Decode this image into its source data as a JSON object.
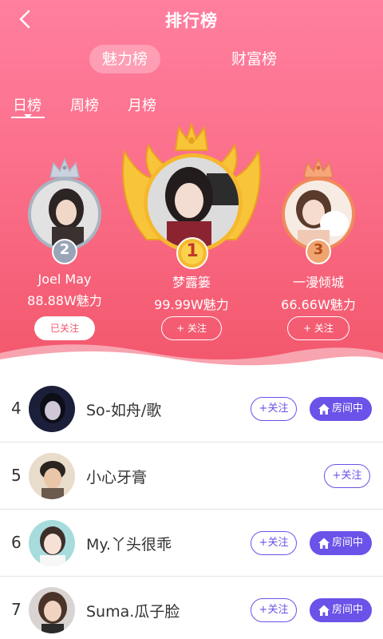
{
  "header": {
    "title": "排行榜",
    "tabs": [
      {
        "label": "魅力榜",
        "active": true
      },
      {
        "label": "财富榜",
        "active": false
      }
    ],
    "periods": [
      {
        "label": "日榜",
        "active": true
      },
      {
        "label": "周榜",
        "active": false
      },
      {
        "label": "月榜",
        "active": false
      }
    ]
  },
  "podium": {
    "first": {
      "rank": "1",
      "name": "梦露篓",
      "score": "99.99W魅力",
      "follow_label": "+ 关注"
    },
    "second": {
      "rank": "2",
      "name": "Joel May",
      "score": "88.88W魅力",
      "follow_label": "已关注"
    },
    "third": {
      "rank": "3",
      "name": "一漫倾城",
      "score": "66.66W魅力",
      "follow_label": "+ 关注"
    }
  },
  "list": [
    {
      "rank": "4",
      "name": "So-如舟/歌",
      "follow_label": "+关注",
      "room_label": "房间中"
    },
    {
      "rank": "5",
      "name": "小心牙膏",
      "follow_label": "+关注",
      "room_label": ""
    },
    {
      "rank": "6",
      "name": "My.丫头很乖",
      "follow_label": "+关注",
      "room_label": "房间中"
    },
    {
      "rank": "7",
      "name": "Suma.瓜子脸",
      "follow_label": "+关注",
      "room_label": "房间中"
    }
  ],
  "colors": {
    "header_top": "#ff7f9f",
    "header_bottom": "#f2566b",
    "accent_purple": "#6b52e8",
    "gold": "#f5b82e",
    "silver": "#a9b4c2",
    "bronze": "#f08a5a"
  }
}
